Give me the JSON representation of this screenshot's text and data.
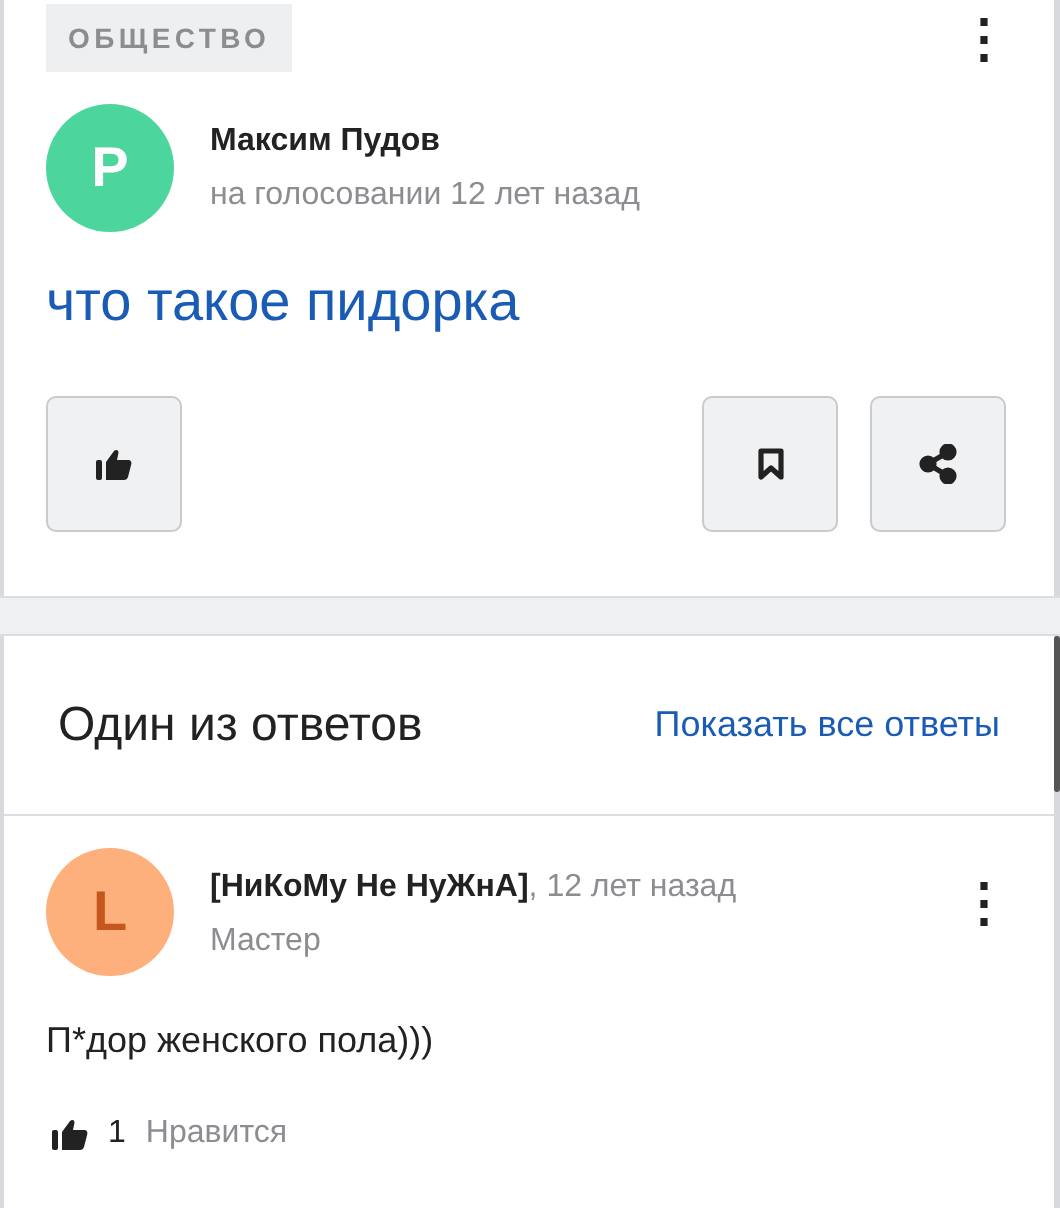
{
  "question": {
    "category": "ОБЩЕСТВО",
    "menu_icon": "⋮",
    "author": {
      "avatar_letter": "P",
      "name": "Максим Пудов",
      "meta": "на голосовании 12 лет назад"
    },
    "title": "что такое пидорка"
  },
  "answers_section": {
    "heading": "Один из ответов",
    "show_all_link": "Показать все ответы"
  },
  "answer": {
    "author": {
      "avatar_letter": "L",
      "name": "[НиКоМу Не НуЖнА]",
      "time": ", 12 лет назад",
      "rank": "Мастер"
    },
    "menu_icon": "⋮",
    "text": "П*дор женского пола)))",
    "likes": "1",
    "like_label": "Нравится"
  }
}
